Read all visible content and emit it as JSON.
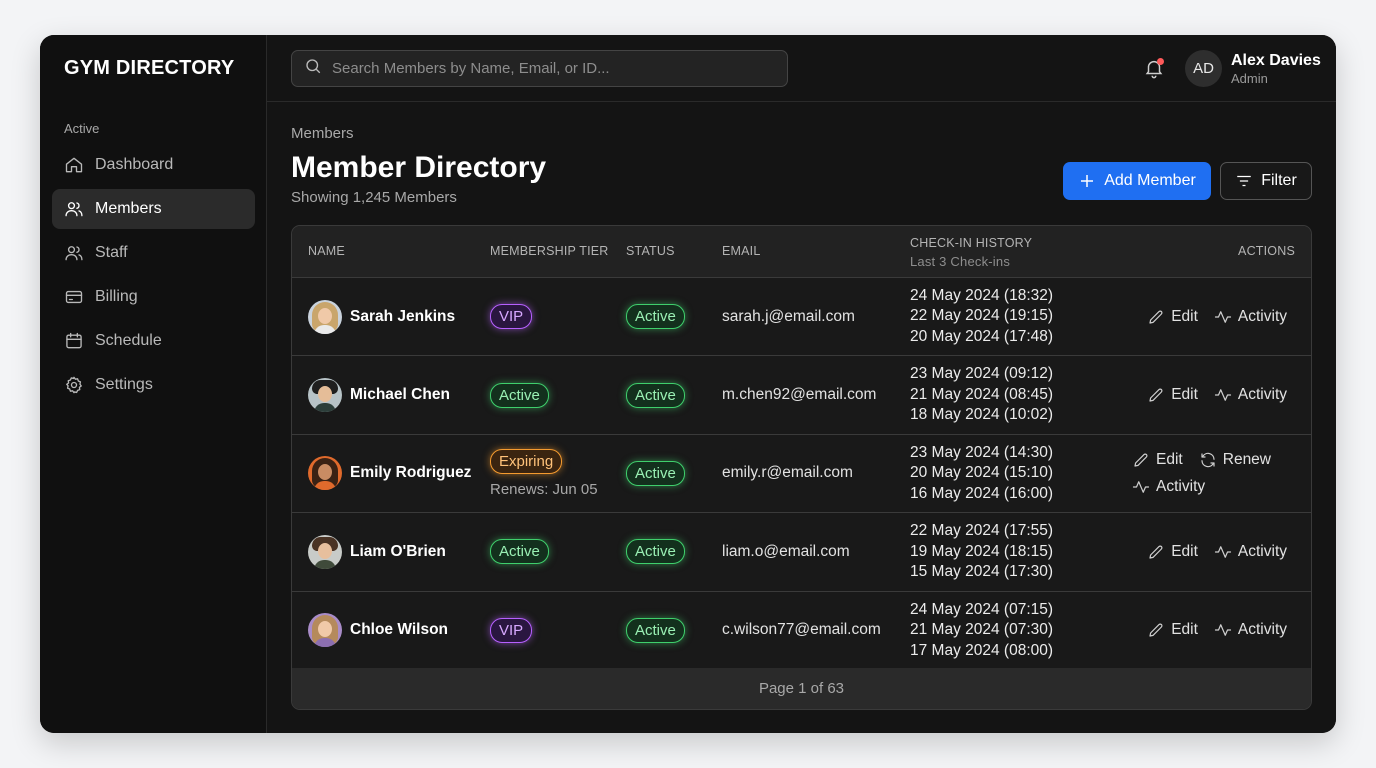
{
  "brand": "GYM DIRECTORY",
  "sidebar": {
    "section_label": "Active",
    "items": [
      {
        "label": "Dashboard",
        "icon": "home-icon",
        "active": false
      },
      {
        "label": "Members",
        "icon": "users-icon",
        "active": true
      },
      {
        "label": "Staff",
        "icon": "staff-icon",
        "active": false
      },
      {
        "label": "Billing",
        "icon": "card-icon",
        "active": false
      },
      {
        "label": "Schedule",
        "icon": "calendar-icon",
        "active": false
      },
      {
        "label": "Settings",
        "icon": "gear-icon",
        "active": false
      }
    ]
  },
  "topbar": {
    "search_placeholder": "Search Members by Name, Email, or ID...",
    "user_initials": "AD",
    "user_name": "Alex Davies",
    "user_role": "Admin"
  },
  "page": {
    "breadcrumb": "Members",
    "title": "Member Directory",
    "subtitle": "Showing 1,245 Members",
    "add_label": "Add Member",
    "filter_label": "Filter"
  },
  "table": {
    "headers": {
      "name": "NAME",
      "tier": "MEMBERSHIP TIER",
      "status": "STATUS",
      "email": "EMAIL",
      "checkin": "CHECK-IN HISTORY",
      "checkin_sub": "Last 3 Check-ins",
      "actions": "ACTIONS"
    },
    "rows": [
      {
        "name": "Sarah Jenkins",
        "tier": "VIP",
        "tier_type": "vip",
        "tier_note": "",
        "status": "Active",
        "email": "sarah.j@email.com",
        "checkins": [
          "24 May 2024 (18:32)",
          "22 May 2024 (19:15)",
          "20 May 2024 (17:48)"
        ],
        "actions": [
          "Edit",
          "Activity"
        ]
      },
      {
        "name": "Michael Chen",
        "tier": "Active",
        "tier_type": "active",
        "tier_note": "",
        "status": "Active",
        "email": "m.chen92@email.com",
        "checkins": [
          "23 May 2024 (09:12)",
          "21 May 2024 (08:45)",
          "18 May 2024 (10:02)"
        ],
        "actions": [
          "Edit",
          "Activity"
        ]
      },
      {
        "name": "Emily Rodriguez",
        "tier": "Expiring",
        "tier_type": "expiring",
        "tier_note": "Renews: Jun 05",
        "status": "Active",
        "email": "emily.r@email.com",
        "checkins": [
          "23 May 2024 (14:30)",
          "20 May 2024 (15:10)",
          "16 May 2024 (16:00)"
        ],
        "actions": [
          "Edit",
          "Renew",
          "Activity"
        ]
      },
      {
        "name": "Liam O'Brien",
        "tier": "Active",
        "tier_type": "active",
        "tier_note": "",
        "status": "Active",
        "email": "liam.o@email.com",
        "checkins": [
          "22 May 2024 (17:55)",
          "19 May 2024 (18:15)",
          "15 May 2024 (17:30)"
        ],
        "actions": [
          "Edit",
          "Activity"
        ]
      },
      {
        "name": "Chloe Wilson",
        "tier": "VIP",
        "tier_type": "vip",
        "tier_note": "",
        "status": "Active",
        "email": "c.wilson77@email.com",
        "checkins": [
          "24 May 2024 (07:15)",
          "21 May 2024 (07:30)",
          "17 May 2024 (08:00)"
        ],
        "actions": [
          "Edit",
          "Activity"
        ]
      }
    ],
    "pagination": "Page 1 of 63"
  },
  "colors": {
    "accent": "#1f6ff2",
    "vip": "#b760ff",
    "active": "#3fcf6c",
    "expiring": "#f59b2f",
    "notification_dot": "#ff5a5a"
  }
}
